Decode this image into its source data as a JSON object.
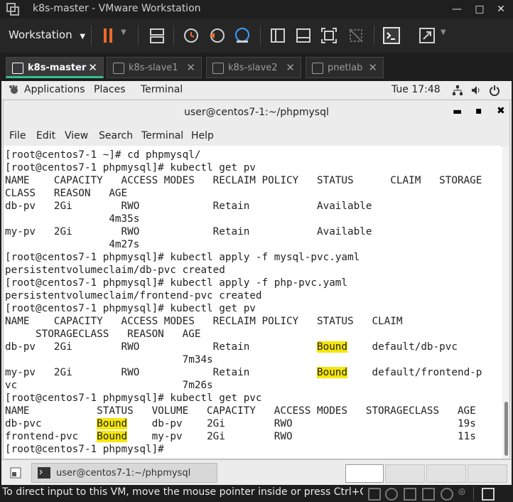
{
  "vmware": {
    "window_title": "k8s-master - VMware Workstation",
    "menu_label": "Workstation",
    "tabs": [
      {
        "label": "k8s-master",
        "active": true
      },
      {
        "label": "k8s-slave1",
        "active": false
      },
      {
        "label": "k8s-slave2",
        "active": false
      },
      {
        "label": "pnetlab",
        "active": false
      }
    ],
    "status_text": "To direct input to this VM, move the mouse pointer inside or press Ctrl+G"
  },
  "gnome": {
    "applications": "Applications",
    "places": "Places",
    "terminal": "Terminal",
    "clock": "Tue 17:48"
  },
  "terminal": {
    "title": "user@centos7-1:~/phpmysql",
    "menu": [
      "File",
      "Edit",
      "View",
      "Search",
      "Terminal",
      "Help"
    ],
    "lines": [
      "[root@centos7-1 ~]# cd phpmysql/",
      "[root@centos7-1 phpmysql]# kubectl get pv",
      "NAME    CAPACITY   ACCESS MODES   RECLAIM POLICY   STATUS      CLAIM   STORAGE",
      "CLASS   REASON   AGE",
      "db-pv   2Gi        RWO            Retain           Available",
      "                 4m35s",
      "my-pv   2Gi        RWO            Retain           Available",
      "                 4m27s",
      "[root@centos7-1 phpmysql]# kubectl apply -f mysql-pvc.yaml",
      "persistentvolumeclaim/db-pvc created",
      "[root@centos7-1 phpmysql]# kubectl apply -f php-pvc.yaml",
      "persistentvolumeclaim/frontend-pvc created",
      "[root@centos7-1 phpmysql]# kubectl get pv",
      "NAME    CAPACITY   ACCESS MODES   RECLAIM POLICY   STATUS   CLAIM",
      "     STORAGECLASS   REASON   AGE",
      "db-pv   2Gi        RWO            Retain           Bound    default/db-pvc",
      "                             7m34s",
      "my-pv   2Gi        RWO            Retain           Bound    default/frontend-p",
      "vc                           7m26s",
      "[root@centos7-1 phpmysql]# kubectl get pvc",
      "NAME           STATUS   VOLUME   CAPACITY   ACCESS MODES   STORAGECLASS   AGE",
      "db-pvc         Bound    db-pv    2Gi        RWO                           19s",
      "frontend-pvc   Bound    my-pv    2Gi        RWO                           11s",
      "[root@centos7-1 phpmysql]# "
    ],
    "highlight_word": "Bound",
    "highlight_color": "#f5e60a"
  },
  "taskbar": {
    "task_label": "user@centos7-1:~/phpmysql"
  }
}
